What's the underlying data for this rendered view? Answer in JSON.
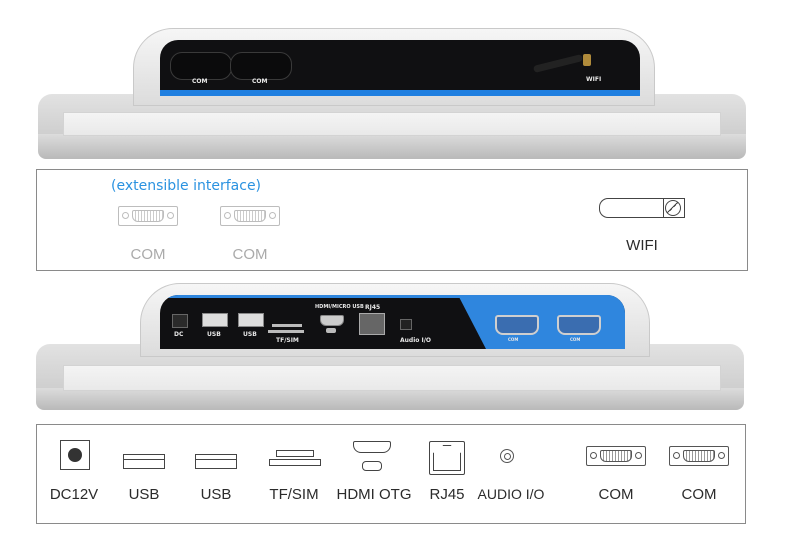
{
  "top_device": {
    "port_labels": [
      "COM",
      "COM",
      "WIFI"
    ]
  },
  "top_diagram": {
    "note": "(extensible interface)",
    "note_color": "#2a92e0",
    "ports": [
      {
        "icon": "db9-com-icon",
        "label": "COM"
      },
      {
        "icon": "db9-com-icon",
        "label": "COM"
      },
      {
        "icon": "wifi-antenna-icon",
        "label": "WIFI"
      }
    ]
  },
  "bottom_device": {
    "port_labels": [
      "DC",
      "USB",
      "USB",
      "TF/SIM",
      "HDMI/MICRO USB",
      "RJ45",
      "Audio I/O",
      "COM",
      "COM"
    ],
    "accent_color": "#2f86de"
  },
  "bottom_diagram": {
    "ports": [
      {
        "icon": "dc-jack-icon",
        "label": "DC12V"
      },
      {
        "icon": "usb-port-icon",
        "label": "USB"
      },
      {
        "icon": "usb-port-icon",
        "label": "USB"
      },
      {
        "icon": "tf-sim-slot-icon",
        "label": "TF/SIM"
      },
      {
        "icon": "hdmi-otg-icon",
        "label": "HDMI OTG"
      },
      {
        "icon": "rj45-icon",
        "label": "RJ45"
      },
      {
        "icon": "audio-jack-icon",
        "label": "AUDIO I/O"
      },
      {
        "icon": "db9-com-icon",
        "label": "COM"
      },
      {
        "icon": "db9-com-icon",
        "label": "COM"
      }
    ]
  }
}
